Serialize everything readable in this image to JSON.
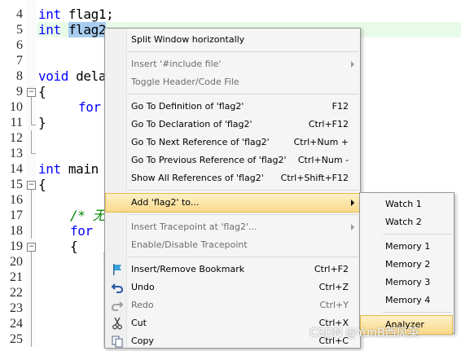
{
  "editor": {
    "line_numbers": [
      "4",
      "5",
      "6",
      "7",
      "8",
      "9",
      "10",
      "11",
      "12",
      "13",
      "14",
      "15",
      "16",
      "17",
      "18",
      "19",
      "20",
      "21",
      "22",
      "23",
      "24",
      "25"
    ],
    "code": {
      "l4_kw": "int",
      "l4_rest": " flag1;",
      "l5_kw": "int",
      "l5_sel": "flag2",
      "l8_kw": "void",
      "l8_rest": " dela",
      "l9": "{",
      "l10_kw": "for",
      "l11": "}",
      "l14_kw": "int",
      "l14_rest": " main",
      "l15": "{",
      "l17_cm": "/* 无",
      "l18_kw": "for",
      "l19": "{"
    },
    "fold_symbol": "−"
  },
  "context_menu": {
    "items": [
      {
        "label": "Split Window horizontally",
        "shortcut": ""
      },
      {
        "label": "Insert '#include file'",
        "shortcut": ""
      },
      {
        "label": "Toggle Header/Code File",
        "shortcut": ""
      },
      {
        "label": "Go To Definition of 'flag2'",
        "shortcut": "F12"
      },
      {
        "label": "Go To Declaration of 'flag2'",
        "shortcut": "Ctrl+F12"
      },
      {
        "label": "Go To Next Reference of 'flag2'",
        "shortcut": "Ctrl+Num +"
      },
      {
        "label": "Go To Previous Reference of 'flag2'",
        "shortcut": "Ctrl+Num -"
      },
      {
        "label": "Show All References of 'flag2'",
        "shortcut": "Ctrl+Shift+F12"
      },
      {
        "label": "Add 'flag2' to...",
        "shortcut": ""
      },
      {
        "label": "Insert Tracepoint at 'flag2'...",
        "shortcut": ""
      },
      {
        "label": "Enable/Disable Tracepoint",
        "shortcut": ""
      },
      {
        "label": "Insert/Remove Bookmark",
        "shortcut": "Ctrl+F2"
      },
      {
        "label": "Undo",
        "shortcut": "Ctrl+Z"
      },
      {
        "label": "Redo",
        "shortcut": "Ctrl+Y"
      },
      {
        "label": "Cut",
        "shortcut": "Ctrl+X"
      },
      {
        "label": "Copy",
        "shortcut": "Ctrl+C"
      }
    ],
    "icons": {
      "bookmark": "bookmark-flag-icon",
      "undo": "undo-arrow-icon",
      "redo": "redo-arrow-icon",
      "cut": "scissors-icon",
      "copy": "copy-icon"
    }
  },
  "submenu": {
    "items": [
      "Watch 1",
      "Watch 2",
      "Memory 1",
      "Memory 2",
      "Memory 3",
      "Memory 4",
      "Analyzer"
    ]
  },
  "watermark": "CSDN @YunB西风英",
  "colors": {
    "keyword": "#0000ff",
    "comment": "#008000",
    "highlight": "#f9d98a",
    "selection": "#a8cdf0"
  }
}
